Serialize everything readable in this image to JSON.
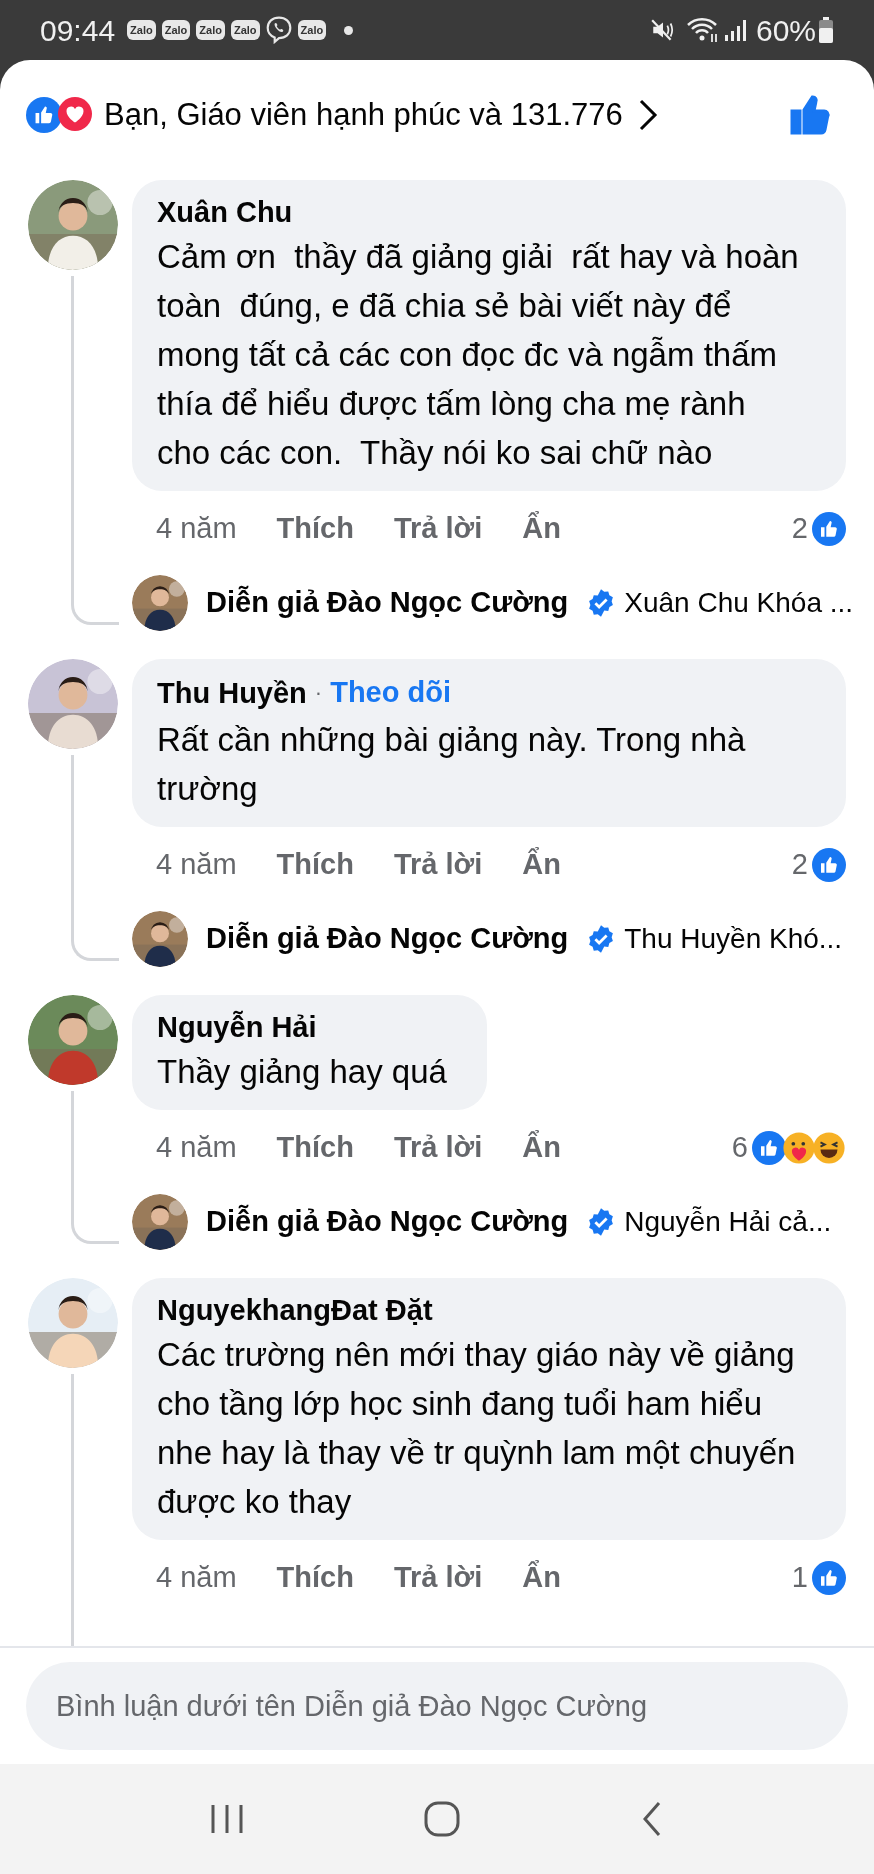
{
  "status_bar": {
    "time": "09:44",
    "notifications": [
      {
        "kind": "zalo",
        "label": "Zalo"
      },
      {
        "kind": "zalo",
        "label": "Zalo"
      },
      {
        "kind": "zalo",
        "label": "Zalo"
      },
      {
        "kind": "zalo",
        "label": "Zalo"
      },
      {
        "kind": "viber"
      },
      {
        "kind": "zalo",
        "label": "Zalo"
      },
      {
        "kind": "dot"
      }
    ],
    "battery": "60%"
  },
  "reactions_header": {
    "text": "Bạn, Giáo viên hạnh phúc và 131.776",
    "liked": true
  },
  "comments": [
    {
      "author": "Xuân Chu",
      "text": "Cảm ơn  thầy đã giảng giải  rất hay và hoàn toàn  đúng, e đã chia sẻ bài viết này để  mong tất cả các con đọc đc và ngẫm thấm thía để hiểu được tấm lòng cha mẹ rành cho các con.  Thầy nói ko sai chữ nào",
      "time": "4 năm",
      "actions": [
        "Thích",
        "Trả lời",
        "Ẩn"
      ],
      "count": "2",
      "reactions": [
        {
          "kind": "like"
        }
      ],
      "reply": {
        "author": "Diễn giả Đào Ngọc Cường",
        "verified": true,
        "preview": "Xuân Chu Khóa ..."
      }
    },
    {
      "author": "Thu Huyền",
      "follow": {
        "separator": "·",
        "label": "Theo dõi"
      },
      "text": "Rất cần những bài giảng này. Trong nhà trường",
      "time": "4 năm",
      "actions": [
        "Thích",
        "Trả lời",
        "Ẩn"
      ],
      "count": "2",
      "reactions": [
        {
          "kind": "like"
        }
      ],
      "reply": {
        "author": "Diễn giả Đào Ngọc Cường",
        "verified": true,
        "preview": "Thu Huyền Khó..."
      }
    },
    {
      "author": "Nguyễn Hải",
      "text": "Thầy giảng hay quá",
      "time": "4 năm",
      "actions": [
        "Thích",
        "Trả lời",
        "Ẩn"
      ],
      "count": "6",
      "reactions": [
        {
          "kind": "like"
        },
        {
          "kind": "care"
        },
        {
          "kind": "haha"
        }
      ],
      "reply": {
        "author": "Diễn giả Đào Ngọc Cường",
        "verified": true,
        "preview": "Nguyễn Hải cả..."
      }
    },
    {
      "author": "NguyekhangĐat Đặt",
      "text": "Các trường nên mới thay giáo này về giảng cho tầng lớp học sinh đang tuổi ham hiểu nhe hay là thay về tr quỳnh lam một chuyến được ko thay",
      "time": "4 năm",
      "actions": [
        "Thích",
        "Trả lời",
        "Ẩn"
      ],
      "count": "1",
      "reactions": [
        {
          "kind": "like"
        }
      ]
    }
  ],
  "composer": {
    "placeholder": "Bình luận dưới tên Diễn giả Đào Ngọc Cường"
  }
}
